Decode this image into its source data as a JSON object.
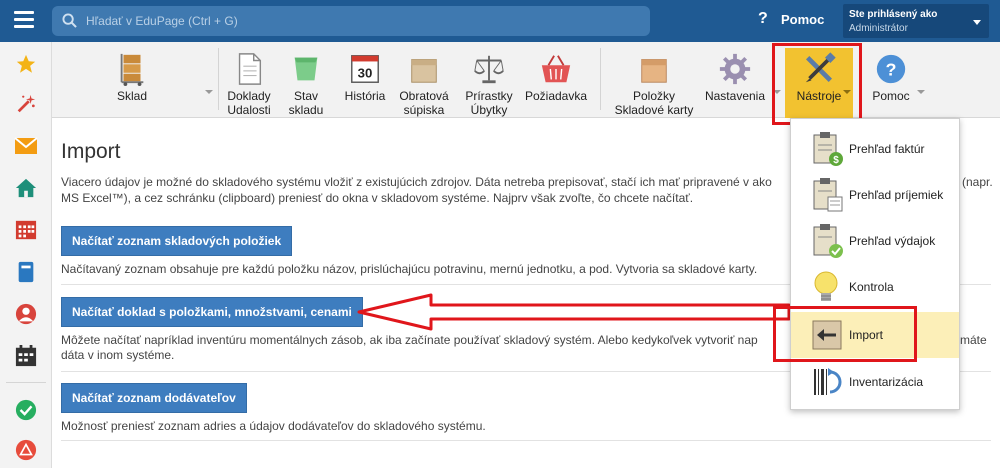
{
  "topbar": {
    "search_placeholder": "Hľadať v EduPage (Ctrl + G)",
    "help_label": "Pomoc",
    "user_line1": "Ste prihlásený ako",
    "user_line2": "Administrátor"
  },
  "toolbar": {
    "sklad": "Sklad",
    "doklady": [
      "Doklady",
      "Udalosti"
    ],
    "stav": [
      "Stav",
      "skladu"
    ],
    "historia": "História",
    "historia_day": "30",
    "obratova": [
      "Obratová",
      "súpiska"
    ],
    "prirastky": [
      "Prírastky",
      "Úbytky"
    ],
    "poziadavka": "Požiadavka",
    "polozky": [
      "Položky",
      "Skladové karty"
    ],
    "nastavenia": "Nastavenia",
    "nastroje": "Nástroje",
    "pomoc": "Pomoc"
  },
  "main": {
    "title": "Import",
    "intro_line1": "Viacero údajov je možné do skladového systému vložiť z existujúcich zdrojov. Dáta netreba prepisovať, stačí ich mať pripravené v ako",
    "intro_line1_tail": "(napr.",
    "intro_line2": "MS Excel™), a cez schránku (clipboard) preniesť do okna v skladovom systéme. Najprv však zvoľte, čo chcete načítať.",
    "btn1": "Načítať zoznam skladových položiek",
    "desc1": "Načítavaný zoznam obsahuje pre každú položku názov, prislúchajúcu potravinu, mernú jednotku, a pod. Vytvoria sa skladové karty.",
    "btn2": "Načítať doklad s položkami, množstvami, cenami",
    "desc2_line1": "Môžete načítať napríklad inventúru momentálnych zásob, ak iba začínate používať skladový systém. Alebo kedykoľvek vytvoriť nap",
    "desc2_line1_tail": "máte",
    "desc2_line2": "dáta v inom systéme.",
    "btn3": "Načítať zoznam dodávateľov",
    "desc3": "Možnosť preniesť zoznam adries a údajov dodávateľov do skladového systému."
  },
  "dropdown": {
    "items": [
      {
        "label": "Prehľad faktúr"
      },
      {
        "label": "Prehľad príjemiek"
      },
      {
        "label": "Prehľad výdajok"
      },
      {
        "label": "Kontrola"
      },
      {
        "label": "Import"
      },
      {
        "label": "Inventarizácia"
      }
    ]
  },
  "colors": {
    "topbar": "#1f5a93",
    "button_blue": "#3e7dbf",
    "highlight_red": "#e0161b",
    "nastroje_yellow": "#f2c230"
  }
}
